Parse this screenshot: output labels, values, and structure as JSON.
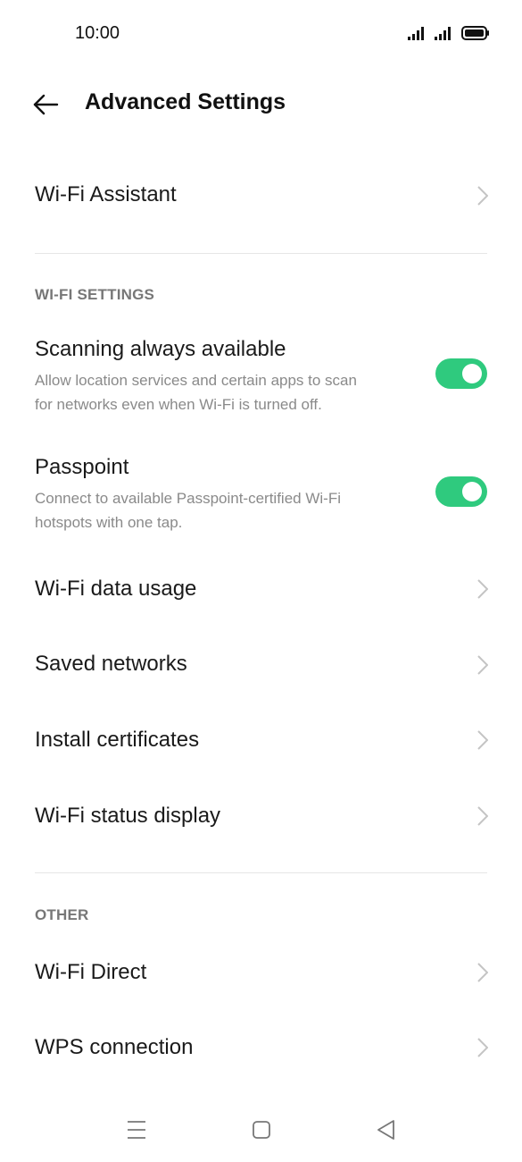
{
  "status_bar": {
    "time": "10:00",
    "icons": [
      "signal-icon",
      "signal-icon",
      "battery-icon"
    ]
  },
  "header": {
    "back_icon": "back-arrow-icon",
    "title": "Advanced Settings"
  },
  "items": {
    "wifi_assistant": "Wi-Fi Assistant",
    "wifi_settings_header": "WI-FI SETTINGS",
    "scanning": {
      "title": "Scanning always available",
      "desc_line1": "Allow location services and certain apps to scan",
      "desc_line2": "for networks even when Wi-Fi is turned off.",
      "enabled": true
    },
    "passpoint": {
      "title": "Passpoint",
      "desc_line1": "Connect to available Passpoint-certified Wi-Fi",
      "desc_line2": "hotspots with one tap.",
      "enabled": true
    },
    "data_usage": "Wi-Fi data usage",
    "saved_networks": "Saved networks",
    "install_certificates": "Install certificates",
    "status_display": "Wi-Fi status display",
    "other_header": "OTHER",
    "wifi_direct": "Wi-Fi Direct",
    "wps": "WPS connection"
  },
  "colors": {
    "toggle_on": "#2fca7e",
    "section_label": "#777777",
    "subtext": "#8a8a8a"
  },
  "nav_bar": [
    "menu-icon",
    "home-icon",
    "back-icon"
  ]
}
